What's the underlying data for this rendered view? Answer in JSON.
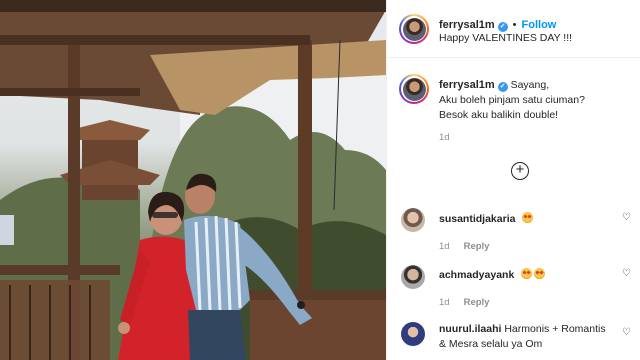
{
  "post": {
    "username": "ferrysal1m",
    "follow_label": "Follow",
    "caption": "Happy VALENTINES DAY !!!"
  },
  "main_comment": {
    "username": "ferrysal1m",
    "lines": [
      "Sayang,",
      "Aku boleh pinjam satu ciuman?",
      "Besok aku balikin double!"
    ],
    "time": "1d"
  },
  "comments": [
    {
      "username": "susantidjakaria",
      "text": "",
      "emoji_count": 1,
      "time": "1d",
      "reply_label": "Reply",
      "avatar_color": "#c9b7a6"
    },
    {
      "username": "achmadyayank",
      "text": "",
      "emoji_count": 2,
      "time": "1d",
      "reply_label": "Reply",
      "avatar_color": "#a9a9a9"
    },
    {
      "username": "nuurul.ilaahi",
      "text": "Harmonis + Romantis & Mesra selalu ya Om",
      "emoji_count": 0,
      "time": "",
      "reply_label": "",
      "avatar_color": "#2f3c7e"
    }
  ],
  "icons": [
    "verified-icon",
    "add-comment-icon",
    "heart-icon"
  ],
  "colors": {
    "accent": "#0095f6",
    "verified": "#3897f0"
  }
}
